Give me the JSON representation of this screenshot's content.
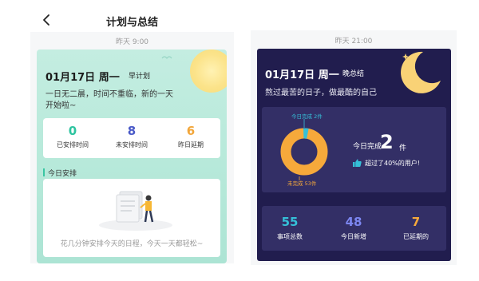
{
  "morning": {
    "page_title": "计划与总结",
    "timestamp": "昨天 9:00",
    "date": "01月17日 周一",
    "plan_tag": "早计划",
    "quote_line1": "一日无二晨，时间不重临，新的一天",
    "quote_line2": "开始啦~",
    "stats": [
      {
        "value": "0",
        "label": "已安排时间",
        "color": "#2ec4a0"
      },
      {
        "value": "8",
        "label": "未安排时间",
        "color": "#4a5ac8"
      },
      {
        "value": "6",
        "label": "昨日延期",
        "color": "#f2a63a"
      }
    ],
    "today_section": "今日安排",
    "empty_hint": "花几分钟安排今天的日程，今天一天都轻松~"
  },
  "evening": {
    "timestamp": "昨天 21:00",
    "date": "01月17日 周一",
    "plan_tag": "晚总结",
    "quote": "熬过最苦的日子，做最酷的自己",
    "donut": {
      "done_label": "今日完成 2件",
      "undone_label": "未完成 53件",
      "done_color": "#35c0d8",
      "undone_color": "#f6a93b",
      "done": 2,
      "undone": 53
    },
    "done_prefix": "今日完成",
    "done_count": "2",
    "done_unit": "件",
    "beat_text": "超过了40%的用户!",
    "stats": [
      {
        "value": "55",
        "label": "事项总数",
        "color": "#35c0d8"
      },
      {
        "value": "48",
        "label": "今日新增",
        "color": "#7c86f0"
      },
      {
        "value": "7",
        "label": "已延期的",
        "color": "#f6a93b"
      }
    ]
  }
}
